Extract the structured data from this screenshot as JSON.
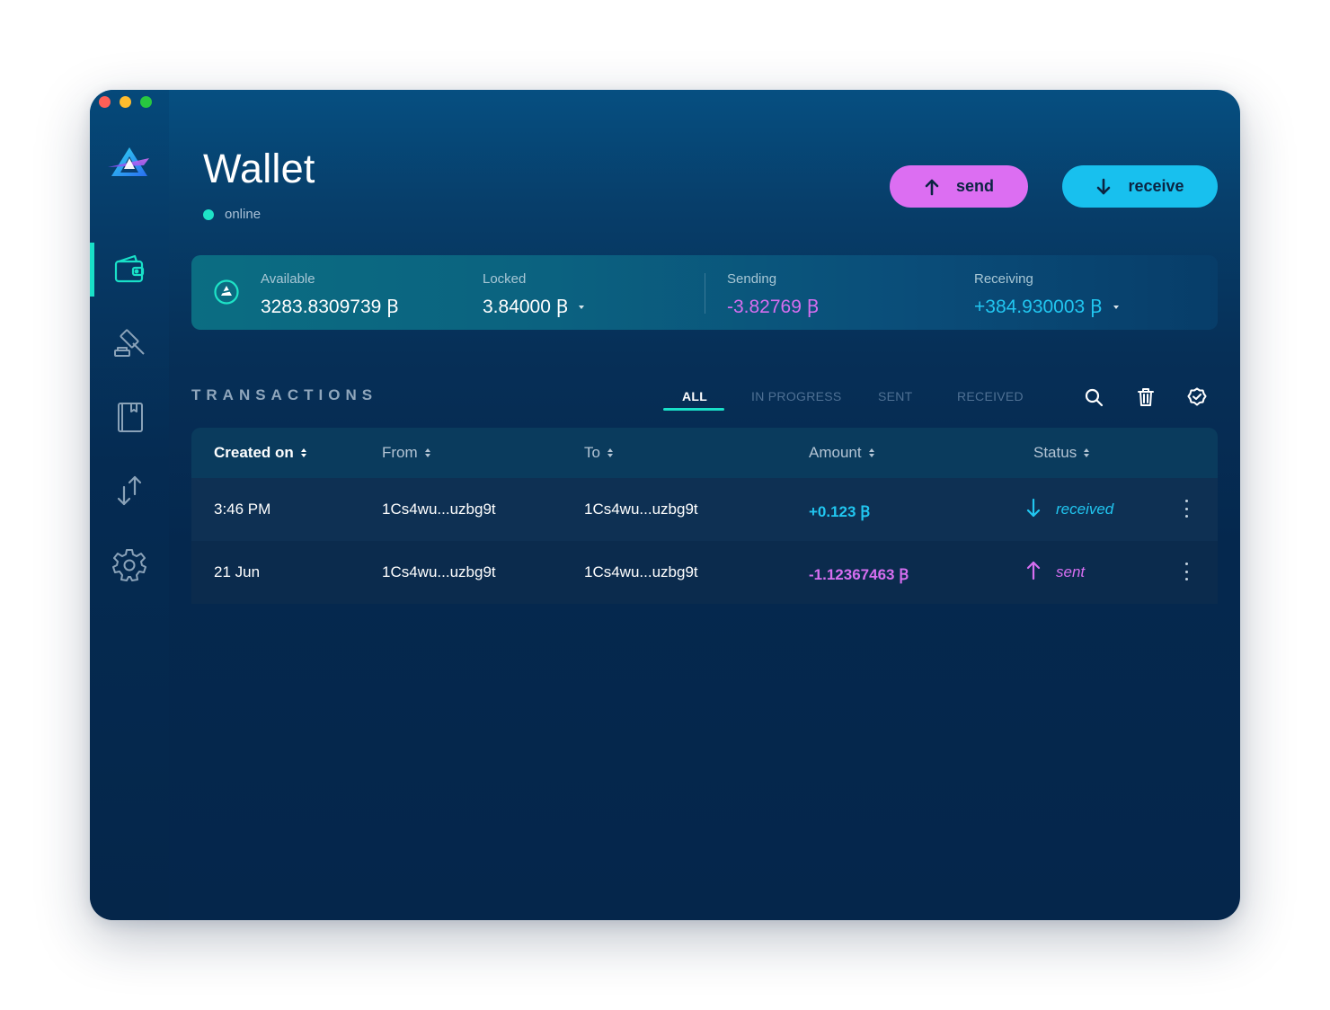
{
  "window": {
    "traffic_lights": [
      "close",
      "minimize",
      "zoom"
    ]
  },
  "sidebar": {
    "logo": "triangle-logo-icon",
    "items": [
      {
        "name": "wallet",
        "icon": "wallet-icon",
        "active": true
      },
      {
        "name": "auction",
        "icon": "gavel-icon",
        "active": false
      },
      {
        "name": "notebook",
        "icon": "notebook-icon",
        "active": false
      },
      {
        "name": "transfer",
        "icon": "arrows-up-down-icon",
        "active": false
      },
      {
        "name": "settings",
        "icon": "gear-icon",
        "active": false
      }
    ]
  },
  "header": {
    "title": "Wallet",
    "status": "online"
  },
  "actions": {
    "send_label": "send",
    "receive_label": "receive"
  },
  "balance": {
    "available_label": "Available",
    "available_value": "3283.8309739 Ꞵ",
    "locked_label": "Locked",
    "locked_value": "3.84000 Ꞵ",
    "sending_label": "Sending",
    "sending_value": "-3.82769 Ꞵ",
    "receiving_label": "Receiving",
    "receiving_value": "+384.930003 Ꞵ"
  },
  "transactions": {
    "heading": "TRANSACTIONS",
    "tabs": [
      "ALL",
      "IN PROGRESS",
      "SENT",
      "RECEIVED"
    ],
    "active_tab": "ALL",
    "tools": [
      "search-icon",
      "trash-icon",
      "badge-check-icon"
    ],
    "columns": [
      "Created on",
      "From",
      "To",
      "Amount",
      "Status"
    ],
    "rows": [
      {
        "created": "3:46 PM",
        "from": "1Cs4wu...uzbg9t",
        "to": "1Cs4wu...uzbg9t",
        "amount": "+0.123 Ꞵ",
        "status": "received"
      },
      {
        "created": "21 Jun",
        "from": "1Cs4wu...uzbg9t",
        "to": "1Cs4wu...uzbg9t",
        "amount": "-1.12367463 Ꞵ",
        "status": "sent"
      }
    ]
  },
  "colors": {
    "accent_teal": "#19e0c8",
    "send_pink": "#dc6ef2",
    "receive_cyan": "#18c0ee"
  }
}
